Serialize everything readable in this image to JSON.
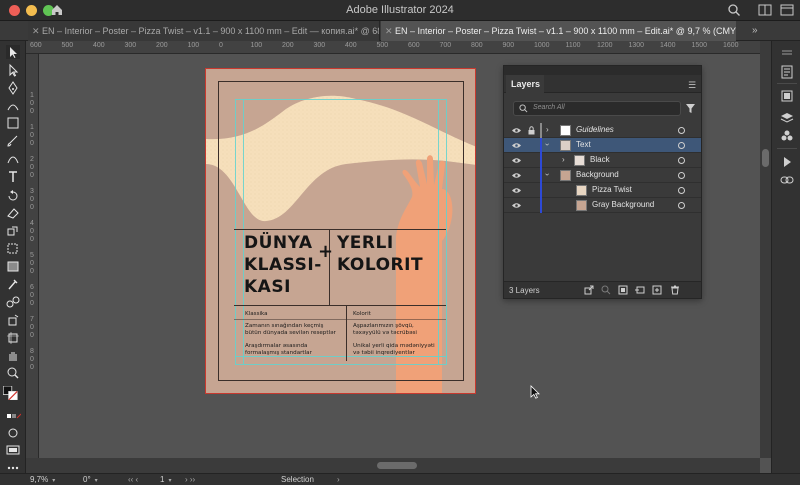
{
  "app": {
    "title": "Adobe Illustrator 2024"
  },
  "tabs": [
    {
      "label": "EN – Interior – Poster – Pizza Twist – v1.1 – 900 x 1100 mm – Edit — копия.ai* @ 68,74 % (C...",
      "active": false
    },
    {
      "label": "EN – Interior – Poster – Pizza Twist – v1.1 – 900 x 1100 mm – Edit.ai* @ 9,7 % (CMYK/Preview)",
      "active": true
    }
  ],
  "ruler": {
    "top_labels": [
      "600",
      "500",
      "400",
      "300",
      "200",
      "100",
      "0",
      "100",
      "200",
      "300",
      "400",
      "500",
      "600",
      "700",
      "800",
      "900",
      "1000",
      "1100",
      "1200",
      "1300",
      "1400",
      "1500",
      "1600"
    ],
    "left_labels": [
      "1",
      "0",
      "0",
      "1",
      "0",
      "0",
      "2",
      "0",
      "0",
      "3",
      "0",
      "0",
      "4",
      "0",
      "0",
      "5",
      "0",
      "0",
      "6",
      "0",
      "0",
      "7",
      "0",
      "0",
      "8",
      "0",
      "0"
    ]
  },
  "poster": {
    "headline_left_1": "DÜNYA",
    "headline_left_2": "KLASSI-",
    "headline_left_3": "KASI",
    "plus": "+",
    "headline_right_1": "YERLI",
    "headline_right_2": "KOLORIT",
    "col_left_title": "Klassika",
    "col_left_line1": "Zamanın sınağından keçmiş",
    "col_left_line2": "bütün dünyada sevilən reseptlər",
    "col_left_line3": "Araşdırmalar əsasında",
    "col_left_line4": "formalaşmış standartlar",
    "col_right_title": "Kolorit",
    "col_right_line1": "Aşpazlarımızın şövqü,",
    "col_right_line2": "təxəyyülü və təcrübəsi",
    "col_right_line3": "Unikal yerli qida mədəniyyəti",
    "col_right_line4": "və təbii inqrediyentlər"
  },
  "layers_panel": {
    "tab_label": "Layers",
    "search_placeholder": "Search All",
    "rows": [
      {
        "name": "Guidelines",
        "italic": true,
        "color": "#5a6ddb"
      },
      {
        "name": "Text",
        "selected": true,
        "color": "#2d49d6"
      },
      {
        "name": "Black",
        "color": "#2d49d6"
      },
      {
        "name": "Background",
        "color": "#2d49d6"
      },
      {
        "name": "Pizza Twist",
        "color": "#2d49d6"
      },
      {
        "name": "Gray Background",
        "color": "#2d49d6"
      }
    ],
    "count_label": "3 Layers"
  },
  "statusbar": {
    "zoom": "9,7%",
    "rotation": "0°",
    "artboard_number": "1",
    "tool": "Selection"
  },
  "colors": {
    "accent_selection": "#3e5778",
    "artboard_bg": "#c6a592",
    "artboard_border": "#c8392f",
    "guides": "#5fd4d0",
    "layer_color": "#2d49d6"
  }
}
